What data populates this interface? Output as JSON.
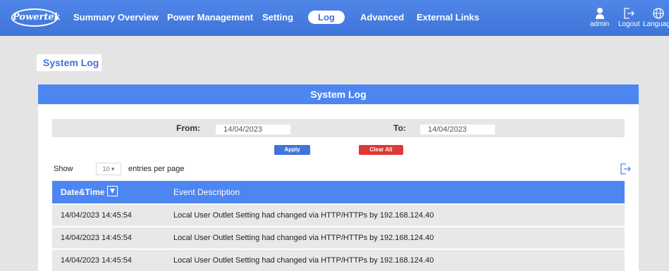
{
  "nav": {
    "logo": "Powertek",
    "items": [
      {
        "label": "Summary Overview"
      },
      {
        "label": "Power Management"
      },
      {
        "label": "Setting"
      },
      {
        "label": "Log",
        "active": true
      },
      {
        "label": "Advanced"
      },
      {
        "label": "External Links"
      }
    ],
    "user": "admin",
    "logout": "Logout",
    "language": "Language"
  },
  "page_title": "System Log",
  "panel": {
    "header": "System Log",
    "from_label": "From:",
    "from_value": "14/04/2023",
    "to_label": "To:",
    "to_value": "14/04/2023",
    "apply_label": "Apply",
    "clear_label": "Clear All",
    "show_label": "Show",
    "entries_value": "10",
    "entries_suffix": "entries per page"
  },
  "table": {
    "columns": [
      "Date&Time",
      "Event Description"
    ],
    "rows": [
      {
        "date": "14/04/2023  14:45:54",
        "desc": "Local User Outlet Setting had changed via HTTP/HTTPs by 192.168.124.40"
      },
      {
        "date": "14/04/2023  14:45:54",
        "desc": "Local User Outlet Setting had changed via HTTP/HTTPs by 192.168.124.40"
      },
      {
        "date": "14/04/2023  14:45:54",
        "desc": "Local User Outlet Setting had changed via HTTP/HTTPs by 192.168.124.40"
      }
    ]
  },
  "colors": {
    "accent": "#4d86f0",
    "nav": "#3f74d8",
    "danger": "#e03737"
  },
  "icons": [
    "user-icon",
    "logout-icon",
    "globe-icon",
    "export-icon",
    "sort-down-icon"
  ]
}
